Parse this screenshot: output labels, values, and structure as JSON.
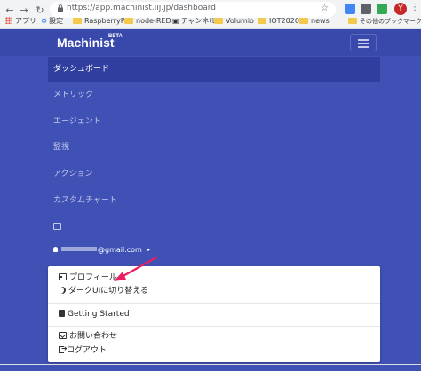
{
  "browser": {
    "url": "https://app.machinist.iij.jp/dashboard",
    "bookmarks": [
      {
        "label": "アプリ"
      },
      {
        "label": "設定"
      },
      {
        "label": "RaspberryPi"
      },
      {
        "label": "node-RED"
      },
      {
        "label": "チャンネル"
      },
      {
        "label": "Volumio"
      },
      {
        "label": "IOT2020"
      },
      {
        "label": "news"
      },
      {
        "label": "その他のブックマーク"
      }
    ],
    "profile_initial": "Y"
  },
  "app": {
    "brand": "Machinist",
    "beta": "BETA",
    "nav": [
      {
        "label": "ダッシュボード"
      },
      {
        "label": "メトリック"
      },
      {
        "label": "エージェント"
      },
      {
        "label": "監視"
      },
      {
        "label": "アクション"
      },
      {
        "label": "カスタムチャート"
      }
    ],
    "user_email_suffix": "@gmail.com",
    "dropdown": {
      "profile": "プロフィール",
      "dark_ui": "ダークUIに切り替える",
      "getting_started": "Getting Started",
      "contact": "お問い合わせ",
      "logout": "ログアウト"
    }
  },
  "colors": {
    "app_bg": "#3f51b5",
    "topbar": "#3949ab",
    "active_nav": "#303f9f",
    "annotation_arrow": "#e91e63"
  }
}
